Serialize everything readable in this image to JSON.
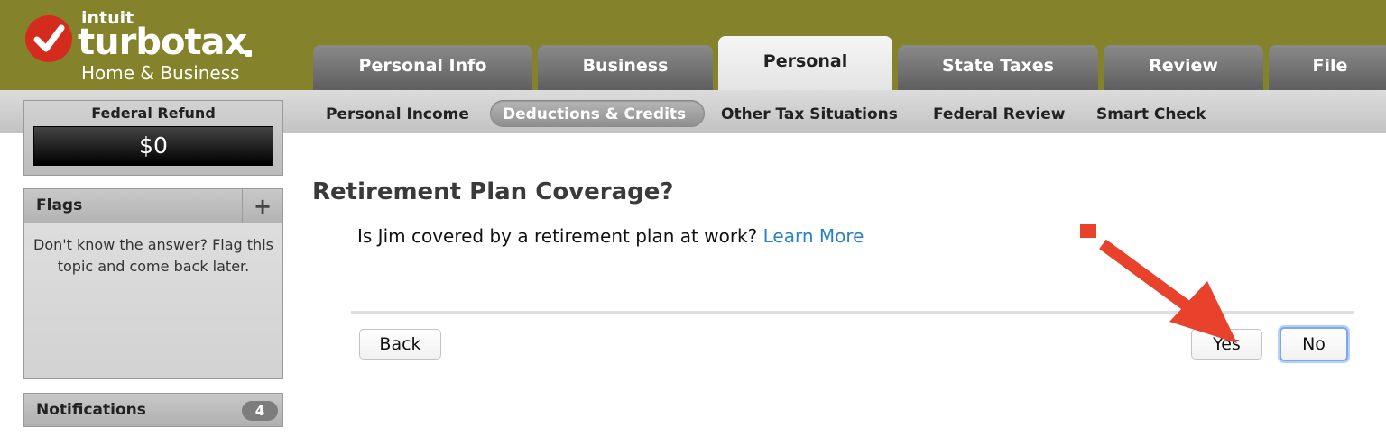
{
  "header": {
    "logo": {
      "company": "intuit",
      "brand": "turbotax",
      "edition": "Home & Business",
      "check_icon": "checkmark-icon",
      "colors": {
        "background": "#84822b",
        "check_circle": "#d52b1e"
      }
    },
    "tabs": [
      {
        "label": "Personal Info",
        "active": false
      },
      {
        "label": "Business",
        "active": false
      },
      {
        "label": "Personal",
        "active": true
      },
      {
        "label": "State Taxes",
        "active": false
      },
      {
        "label": "Review",
        "active": false
      },
      {
        "label": "File",
        "active": false
      }
    ]
  },
  "subnav": {
    "items": [
      {
        "label": "Personal Income",
        "active": false
      },
      {
        "label": "Deductions & Credits",
        "active": true
      },
      {
        "label": "Other Tax Situations",
        "active": false
      },
      {
        "label": "Federal Review",
        "active": false
      },
      {
        "label": "Smart Check",
        "active": false
      }
    ]
  },
  "sidebar": {
    "refund": {
      "label": "Federal Refund",
      "value": "$0"
    },
    "flags": {
      "title": "Flags",
      "add_icon": "plus-icon",
      "add_label": "+",
      "text": "Don't know the answer? Flag this topic and come back later."
    },
    "notifications": {
      "title": "Notifications",
      "count": "4"
    }
  },
  "main": {
    "title": "Retirement Plan Coverage?",
    "question": "Is Jim covered by a retirement plan at work?",
    "learn_more": "Learn More",
    "buttons": {
      "back": "Back",
      "yes": "Yes",
      "no": "No"
    }
  },
  "annotation": {
    "type": "arrow",
    "color": "#e8412c",
    "points_to": "yes-button"
  }
}
